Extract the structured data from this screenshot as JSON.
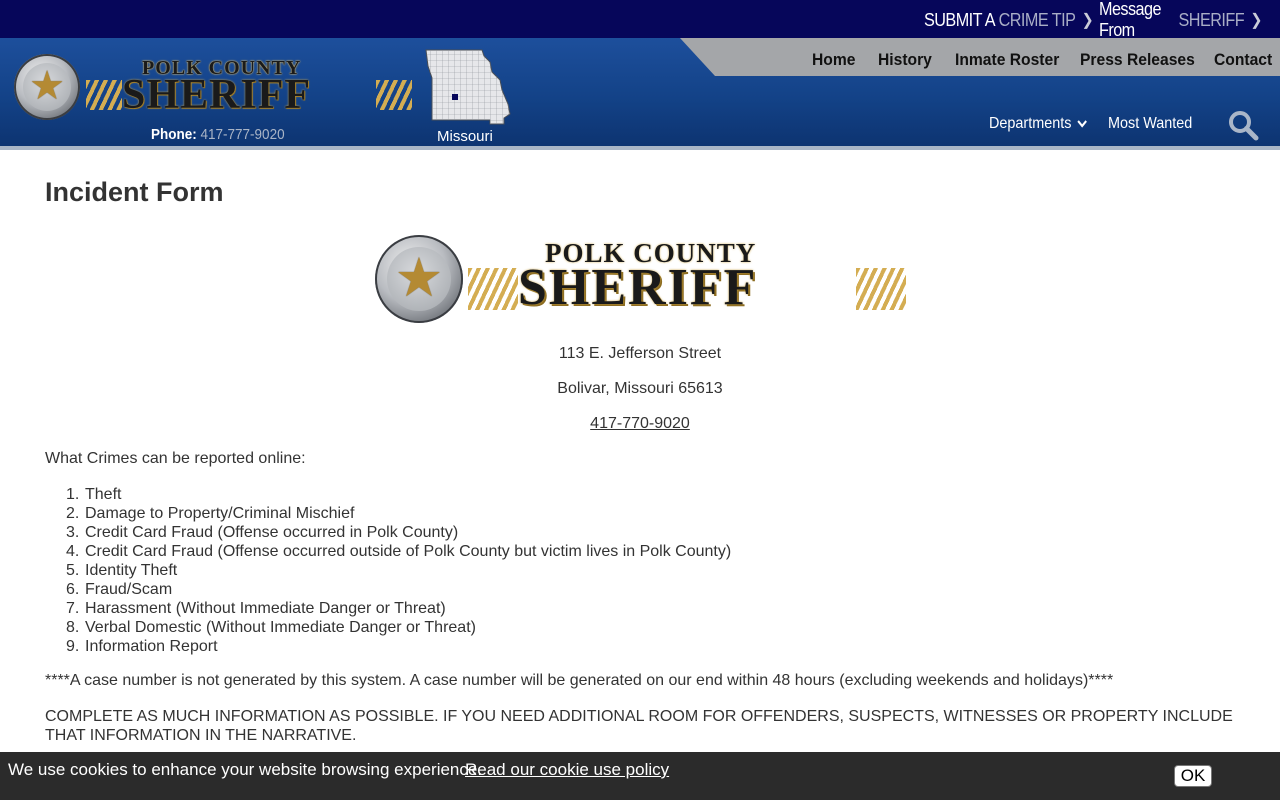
{
  "topbar": {
    "crime_tip": {
      "lead": "SUBMIT A",
      "accent": "CRIME TIP"
    },
    "message": {
      "lead": "Message From",
      "accent": "SHERIFF"
    }
  },
  "header": {
    "logo_line1": "POLK COUNTY",
    "logo_line2": "SHERIFF",
    "phone_label": "Phone:",
    "phone_number": "417-777-9020",
    "state_label": "Missouri"
  },
  "nav": {
    "top": [
      "Home",
      "History",
      "Inmate Roster",
      "Press Releases",
      "Contact"
    ],
    "departments": "Departments",
    "most_wanted": "Most Wanted"
  },
  "main": {
    "title": "Incident Form",
    "logo_line1": "POLK COUNTY",
    "logo_line2": "SHERIFF",
    "address_line1": "113 E. Jefferson Street",
    "address_line2": "Bolivar, Missouri 65613",
    "phone": "417-770-9020",
    "intro": "What Crimes can be reported online:",
    "crimes": [
      "Theft",
      "Damage to Property/Criminal Mischief",
      "Credit Card Fraud (Offense occurred in Polk County)",
      "Credit Card Fraud (Offense occurred outside of Polk County but victim lives in Polk County)",
      "Identity Theft",
      "Fraud/Scam",
      "Harassment (Without Immediate Danger or Threat)",
      "Verbal Domestic (Without Immediate Danger or Threat)",
      "Information Report"
    ],
    "notice_case": "****A case number is not generated by this system.  A case number will be generated on our end within 48 hours (excluding weekends and holidays)****",
    "notice_complete": "COMPLETE AS MUCH INFORMATION AS POSSIBLE.  IF YOU NEED ADDITIONAL ROOM FOR OFFENDERS, SUSPECTS, WITNESSES OR PROPERTY INCLUDE THAT INFORMATION IN THE NARRATIVE."
  },
  "cookie": {
    "text": "We use cookies to enhance your website browsing experience.",
    "link": "Read our cookie use policy",
    "trailing": ".",
    "ok": "OK"
  },
  "colors": {
    "topbar": "#06065a",
    "header_blue": "#134287",
    "nav_gray": "#a4a6a9",
    "gold": "#d4ad52",
    "cookie_bg": "#2b2b2b"
  },
  "icons": [
    "chevron-right-icon",
    "chevron-down-icon",
    "search-icon",
    "star-badge-icon",
    "missouri-map-icon"
  ]
}
